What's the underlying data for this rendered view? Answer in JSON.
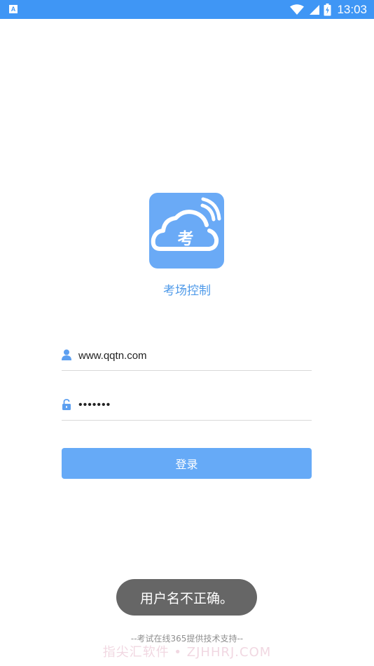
{
  "status_bar": {
    "notification_icon_letter": "A",
    "time": "13:03",
    "icons": [
      "wifi-icon",
      "signal-icon",
      "battery-icon"
    ]
  },
  "app": {
    "logo_char": "考",
    "name": "考场控制"
  },
  "login_form": {
    "username_value": "www.qqtn.com",
    "password_value": "•••••••",
    "login_button_label": "登录"
  },
  "toast": {
    "message": "用户名不正确。"
  },
  "footer": {
    "text": "--考试在线365提供技术支持--",
    "watermark": "指尖汇软件 • ZJHHRJ.COM"
  },
  "colors": {
    "accent": "#3f96f5",
    "logo_bg": "#6aaaf6",
    "button_bg": "#66aaf7",
    "toast_bg": "#666666"
  }
}
